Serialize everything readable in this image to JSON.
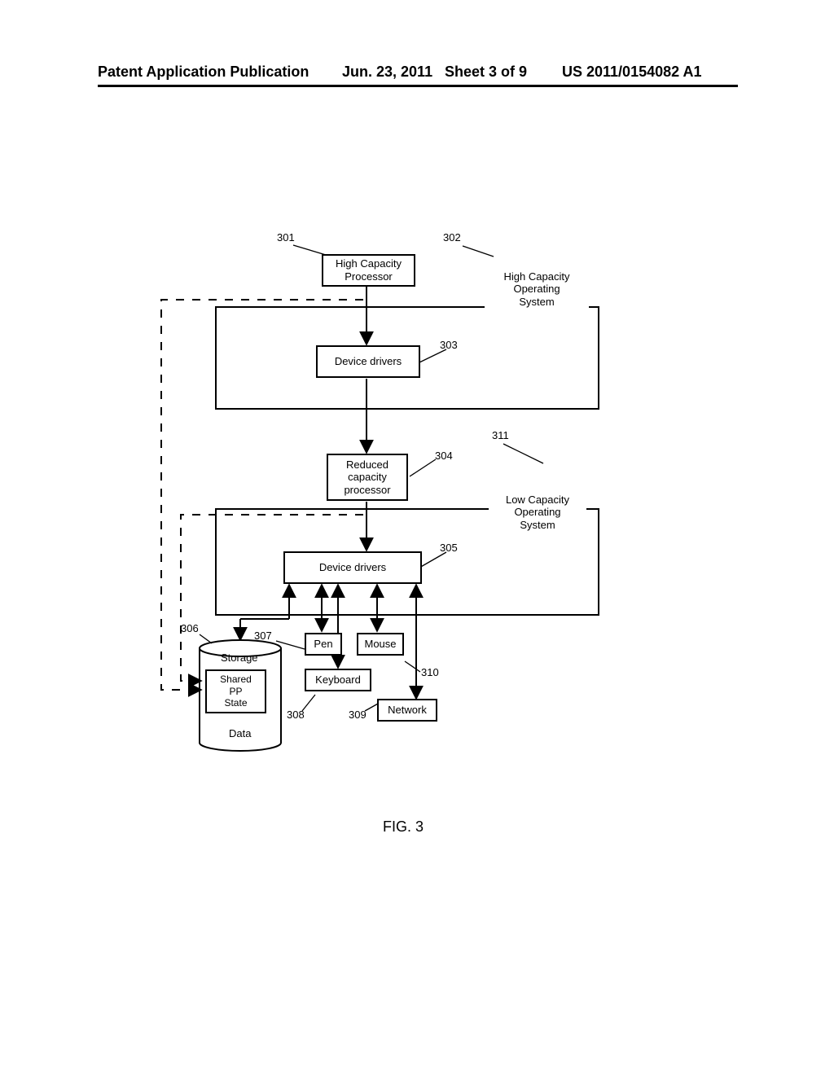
{
  "header": {
    "pubLabel": "Patent Application Publication",
    "dateLabel": "Jun. 23, 2011",
    "sheetLabel": "Sheet 3 of 9",
    "pubNumber": "US 2011/0154082 A1"
  },
  "figure": {
    "caption": "FIG. 3"
  },
  "refs": {
    "r301": "301",
    "r302": "302",
    "r303": "303",
    "r304": "304",
    "r305": "305",
    "r306": "306",
    "r307": "307",
    "r308": "308",
    "r309": "309",
    "r310": "310",
    "r311": "311"
  },
  "blocks": {
    "hcp": "High Capacity\nProcessor",
    "hcos": "High Capacity\nOperating\nSystem",
    "dd1": "Device drivers",
    "rcp": "Reduced\ncapacity\nprocessor",
    "lcos": "Low Capacity\nOperating\nSystem",
    "dd2": "Device drivers",
    "storage": "Storage",
    "shared": "Shared\nPP\nState",
    "data": "Data",
    "pen": "Pen",
    "mouse": "Mouse",
    "keyboard": "Keyboard",
    "network": "Network"
  },
  "chart_data": {
    "type": "diagram",
    "title": "FIG. 3",
    "nodes": [
      {
        "id": "301",
        "label": "High Capacity Processor"
      },
      {
        "id": "302",
        "label": "High Capacity Operating System",
        "contains": [
          "303"
        ]
      },
      {
        "id": "303",
        "label": "Device drivers"
      },
      {
        "id": "304",
        "label": "Reduced capacity processor"
      },
      {
        "id": "311",
        "label": "Low Capacity Operating System",
        "contains": [
          "305"
        ]
      },
      {
        "id": "305",
        "label": "Device drivers"
      },
      {
        "id": "306",
        "label": "Storage",
        "contains": [
          "Shared PP State",
          "Data"
        ]
      },
      {
        "id": "307",
        "label": "Pen"
      },
      {
        "id": "308",
        "label": "Keyboard"
      },
      {
        "id": "309",
        "label": "Network"
      },
      {
        "id": "310",
        "label": "Mouse"
      }
    ],
    "edges": [
      {
        "from": "301",
        "to": "303",
        "style": "solid",
        "head": "arrow"
      },
      {
        "from": "303",
        "to": "304",
        "style": "solid",
        "head": "arrow"
      },
      {
        "from": "304",
        "to": "305",
        "style": "solid",
        "head": "arrow"
      },
      {
        "from": "305",
        "to": "306",
        "style": "solid",
        "head": "double-arrow"
      },
      {
        "from": "305",
        "to": "307",
        "style": "solid",
        "head": "double-arrow"
      },
      {
        "from": "305",
        "to": "308",
        "style": "solid",
        "head": "double-arrow"
      },
      {
        "from": "305",
        "to": "309",
        "style": "solid",
        "head": "double-arrow"
      },
      {
        "from": "305",
        "to": "310",
        "style": "solid",
        "head": "double-arrow"
      },
      {
        "from": "301",
        "to": "Shared PP State",
        "style": "dashed",
        "head": "arrow"
      },
      {
        "from": "304",
        "to": "Shared PP State",
        "style": "dashed",
        "head": "arrow"
      }
    ]
  }
}
